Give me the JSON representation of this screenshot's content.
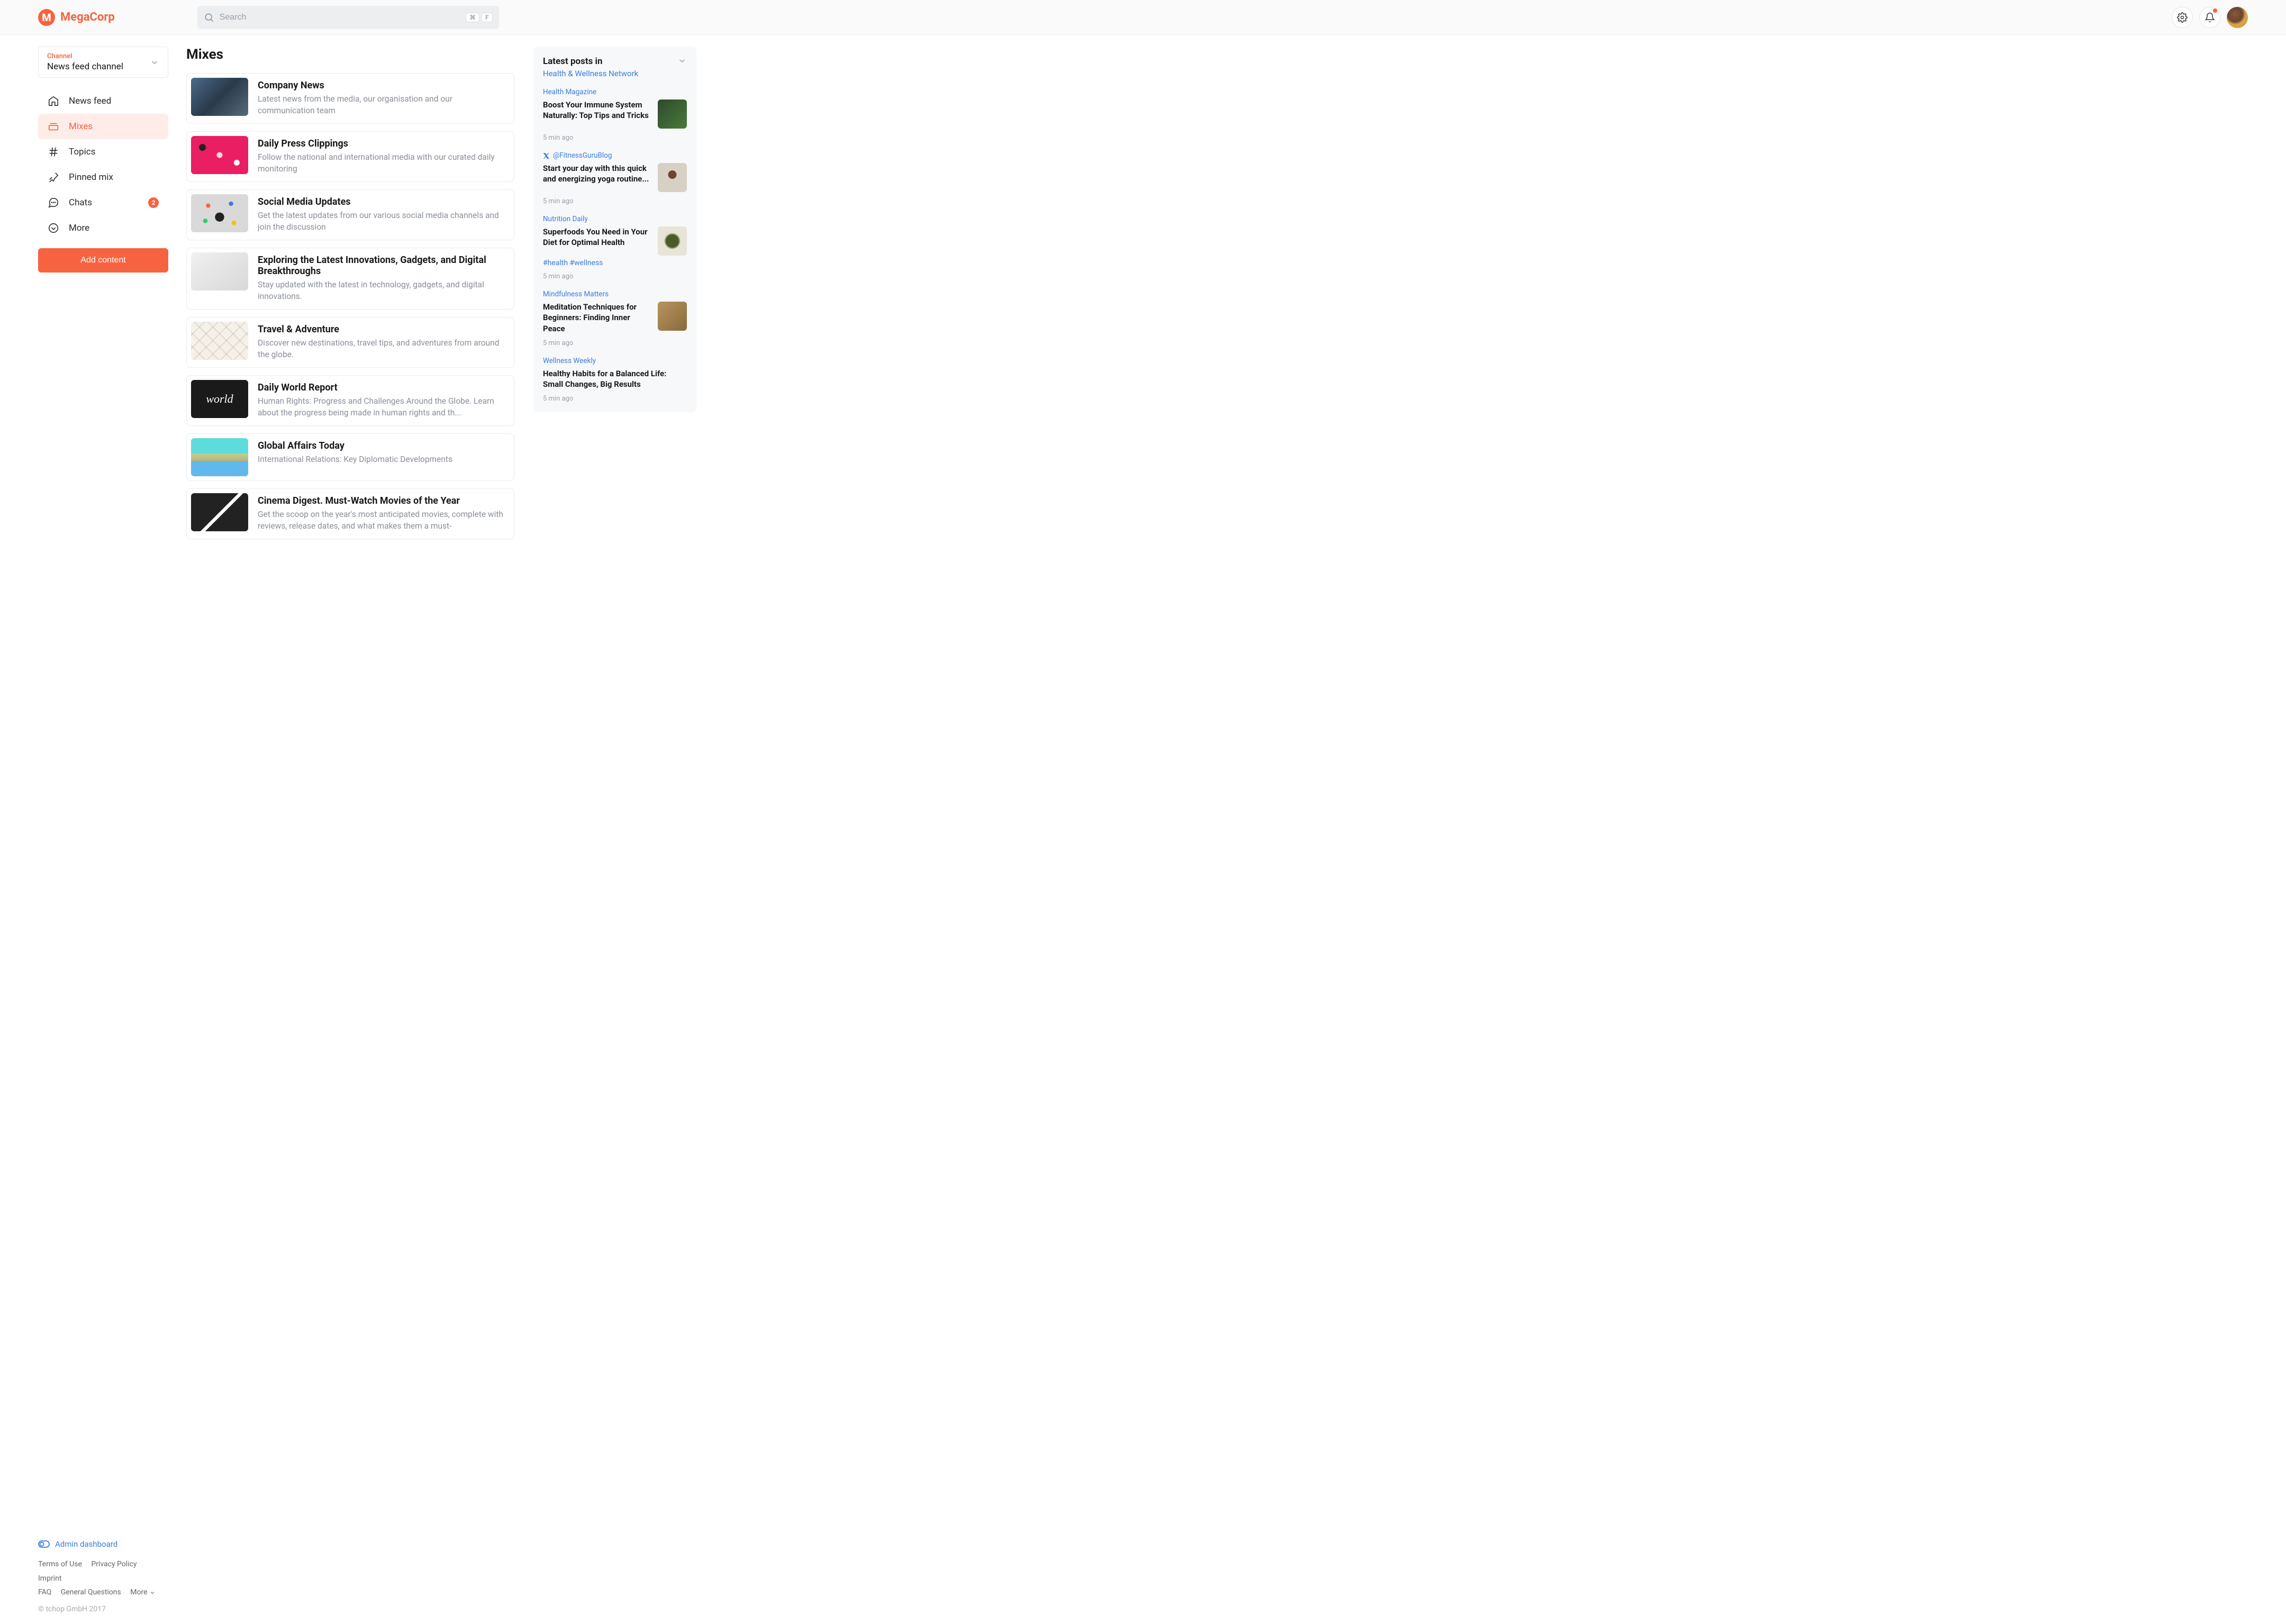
{
  "header": {
    "brand": "MegaCorp",
    "search_placeholder": "Search",
    "kbd1": "⌘",
    "kbd2": "F"
  },
  "sidebar": {
    "channel_label": "Channel",
    "channel_name": "News feed channel",
    "nav": [
      {
        "label": "News feed"
      },
      {
        "label": "Mixes"
      },
      {
        "label": "Topics"
      },
      {
        "label": "Pinned mix"
      },
      {
        "label": "Chats",
        "badge": "2"
      },
      {
        "label": "More"
      }
    ],
    "add_button": "Add content",
    "admin": "Admin dashboard",
    "footer": {
      "l1": "Terms of Use",
      "l2": "Privacy Policy",
      "l3": "Imprint",
      "l4": "FAQ",
      "l5": "General Questions",
      "l6": "More"
    },
    "copyright": "© tchop GmbH 2017"
  },
  "main": {
    "heading": "Mixes",
    "mixes": [
      {
        "title": "Company News",
        "desc": "Latest news from the media, our organisation and our communication team"
      },
      {
        "title": "Daily Press Clippings",
        "desc": "Follow the national and international media with our curated daily monitoring"
      },
      {
        "title": "Social Media Updates",
        "desc": "Get the latest updates from our various social media channels and join the discussion"
      },
      {
        "title": "Exploring the Latest Innovations, Gadgets, and Digital Breakthroughs",
        "desc": "Stay updated with the latest in technology, gadgets, and digital innovations."
      },
      {
        "title": "Travel & Adventure",
        "desc": "Discover new destinations, travel tips, and adventures from around the globe."
      },
      {
        "title": "Daily World Report",
        "desc": "Human Rights: Progress and Challenges Around the Globe. Learn about the progress being made in human rights and th..."
      },
      {
        "title": "Global Affairs Today",
        "desc": "International Relations: Key Diplomatic Developments"
      },
      {
        "title": "Cinema Digest. Must-Watch Movies of the Year",
        "desc": "Get the scoop on the year's most anticipated movies, complete with reviews, release dates, and what makes them a must-"
      }
    ]
  },
  "right": {
    "title": "Latest posts in",
    "subtitle": "Health & Wellness Network",
    "posts": [
      {
        "src": "Health Magazine",
        "title": "Boost Your Immune System Naturally: Top Tips and Tricks",
        "time": "5 min ago",
        "thumb": true
      },
      {
        "src": "@FitnessGuruBlog",
        "title": "Start your day with this quick and energizing yoga routine...",
        "time": "5 min ago",
        "thumb": true,
        "x": true
      },
      {
        "src": "Nutrition Daily",
        "title": "Superfoods You Need in Your Diet for Optimal Health",
        "time": "5 min ago",
        "tags": "#health #wellness",
        "thumb": true
      },
      {
        "src": "Mindfulness Matters",
        "title": "Meditation Techniques for Beginners: Finding Inner Peace",
        "time": "5 min ago",
        "thumb": true
      },
      {
        "src": "Wellness Weekly",
        "title": "Healthy Habits for a Balanced Life: Small Changes, Big Results",
        "time": "5 min ago",
        "thumb": false
      }
    ]
  },
  "thumb_styles": [
    "background: linear-gradient(135deg, #4a6a8a 0%, #2a3a4a 50%, #556b7a 100%);",
    "background: #e91e63; background-image: radial-gradient(circle at 50% 50%, rgba(255,255,255,0.8) 8%, transparent 9%), radial-gradient(circle at 20% 30%, #222 6%, transparent 7%), radial-gradient(circle at 80% 70%, #fff 5%, transparent 6%);",
    "background: #d9d9d9; background-image: radial-gradient(circle at 50% 60%, #222 12%, transparent 13%), radial-gradient(circle at 30% 30%, #f76340 4%, transparent 5%), radial-gradient(circle at 70% 25%, #3b7ddd 4%, transparent 5%), radial-gradient(circle at 25% 70%, #2ecc71 4%, transparent 5%), radial-gradient(circle at 75% 75%, #f1c40f 4%, transparent 5%);",
    "background: linear-gradient(145deg, #f0f0f0 0%, #d8d8d8 100%);",
    "background: #f5f0e8; background-image: repeating-linear-gradient(45deg, rgba(120,100,80,0.15) 0 2px, transparent 2px 18px), repeating-linear-gradient(-45deg, rgba(120,100,80,0.15) 0 2px, transparent 2px 18px);",
    "background: #1a1a1a; color:#fff; display:flex; align-items:center; justify-content:center;",
    "background: #5edbdb; background-image: linear-gradient(180deg, transparent 40%, rgba(255,200,100,0.6) 40%, rgba(255,150,50,0.6) 60%, rgba(100,150,255,0.5) 60%);",
    "background: #fff; background-image: linear-gradient(135deg, #222 0%, #222 50%, #fff 50%, #fff 55%, #222 55%);"
  ],
  "post_thumb_styles": [
    "background: linear-gradient(135deg, #2d4a2d 0%, #4a7a3a 100%);",
    "background: #d8cfc5; background-image: radial-gradient(circle at 50% 40%, #6b4530 18%, transparent 19%);",
    "background: #e8e4d8; background-image: radial-gradient(ellipse at 50% 50%, #4a5a2a 30%, #6a7a3a 32%, transparent 40%);",
    "background: linear-gradient(135deg, #b89560 0%, #8a6a3a 100%);",
    ""
  ]
}
